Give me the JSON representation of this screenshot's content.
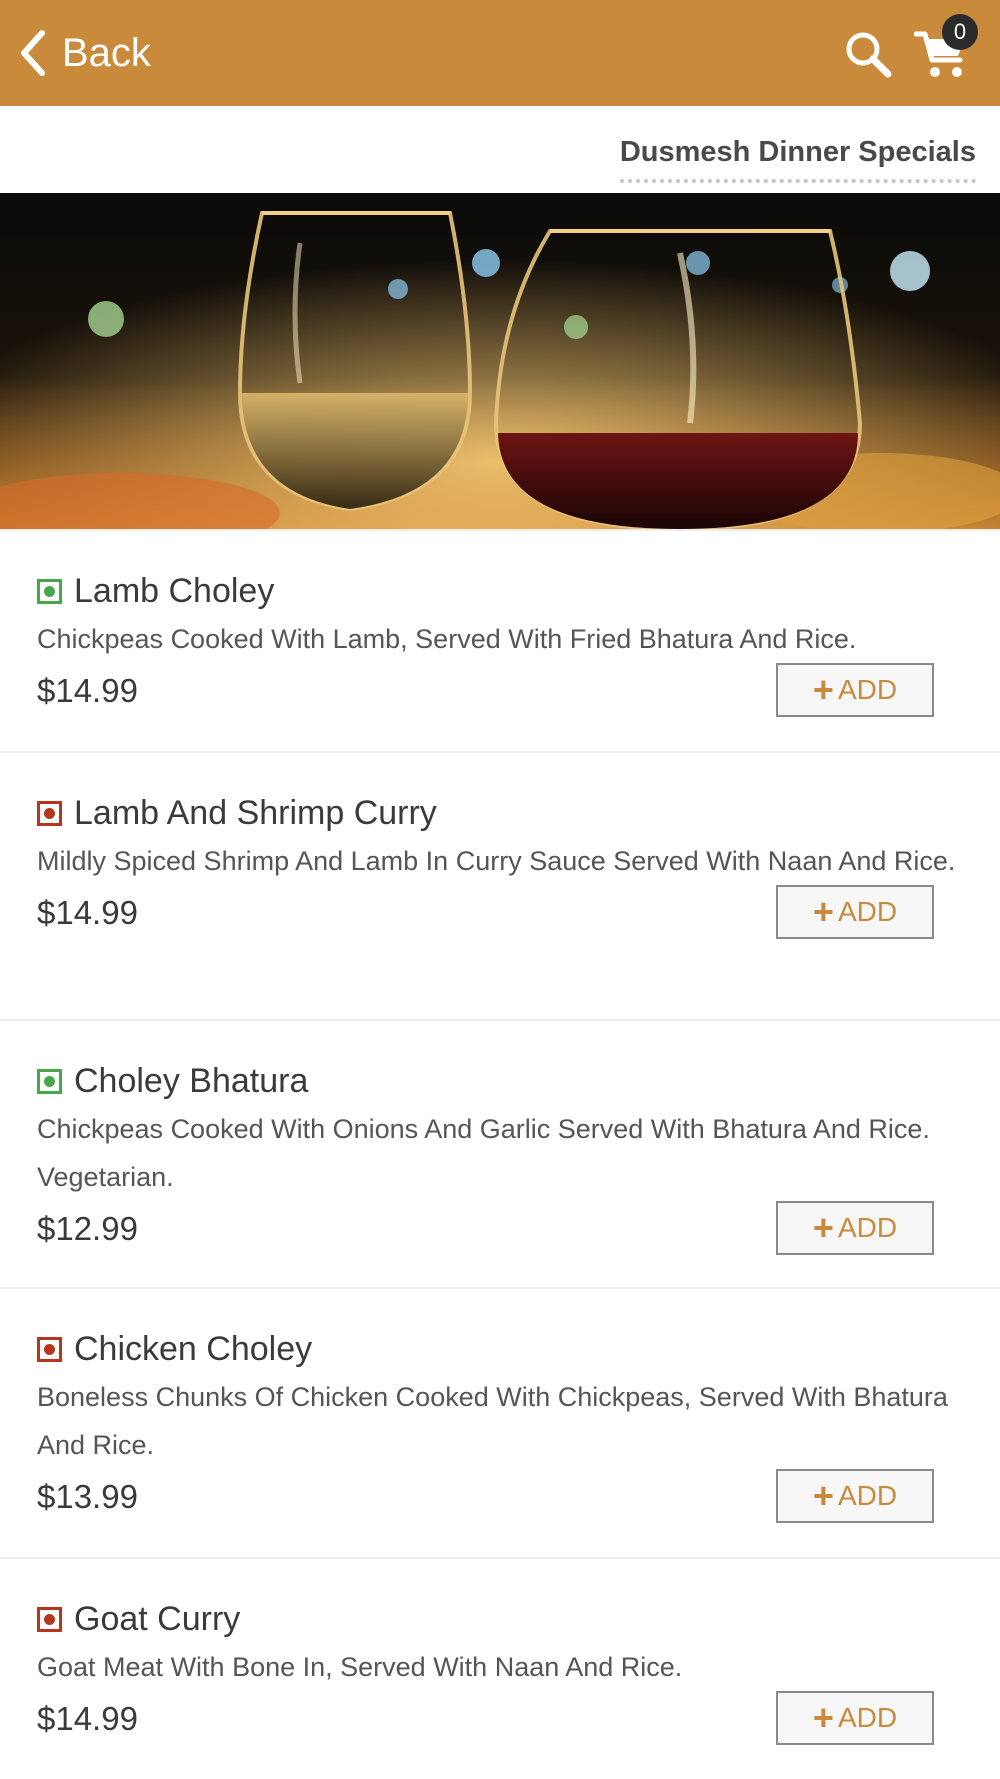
{
  "header": {
    "back_label": "Back",
    "cart_count": "0",
    "accent_color": "#c98a3c"
  },
  "category": {
    "title": "Dusmesh Dinner Specials"
  },
  "banner": {
    "icon": "wine-glasses-image"
  },
  "menu": {
    "items": [
      {
        "name": "Lamb Choley",
        "type": "veg",
        "description": "Chickpeas Cooked With Lamb, Served With Fried Bhatura And Rice.",
        "price": "$14.99",
        "add_label": "ADD"
      },
      {
        "name": "Lamb And Shrimp Curry",
        "type": "nonveg",
        "description": "Mildly Spiced Shrimp And Lamb In Curry Sauce Served With Naan And Rice.",
        "price": "$14.99",
        "add_label": "ADD"
      },
      {
        "name": "Choley Bhatura",
        "type": "veg",
        "description": "Chickpeas Cooked With Onions And Garlic Served With Bhatura And Rice. Vegetarian.",
        "price": "$12.99",
        "add_label": "ADD"
      },
      {
        "name": "Chicken Choley",
        "type": "nonveg",
        "description": "Boneless Chunks Of Chicken Cooked With Chickpeas, Served With Bhatura And Rice.",
        "price": "$13.99",
        "add_label": "ADD"
      },
      {
        "name": "Goat Curry",
        "type": "nonveg",
        "description": "Goat Meat With Bone In, Served With Naan And Rice.",
        "price": "$14.99",
        "add_label": "ADD"
      }
    ]
  },
  "colors": {
    "veg": "#4aa64a",
    "nonveg": "#b6361d"
  }
}
